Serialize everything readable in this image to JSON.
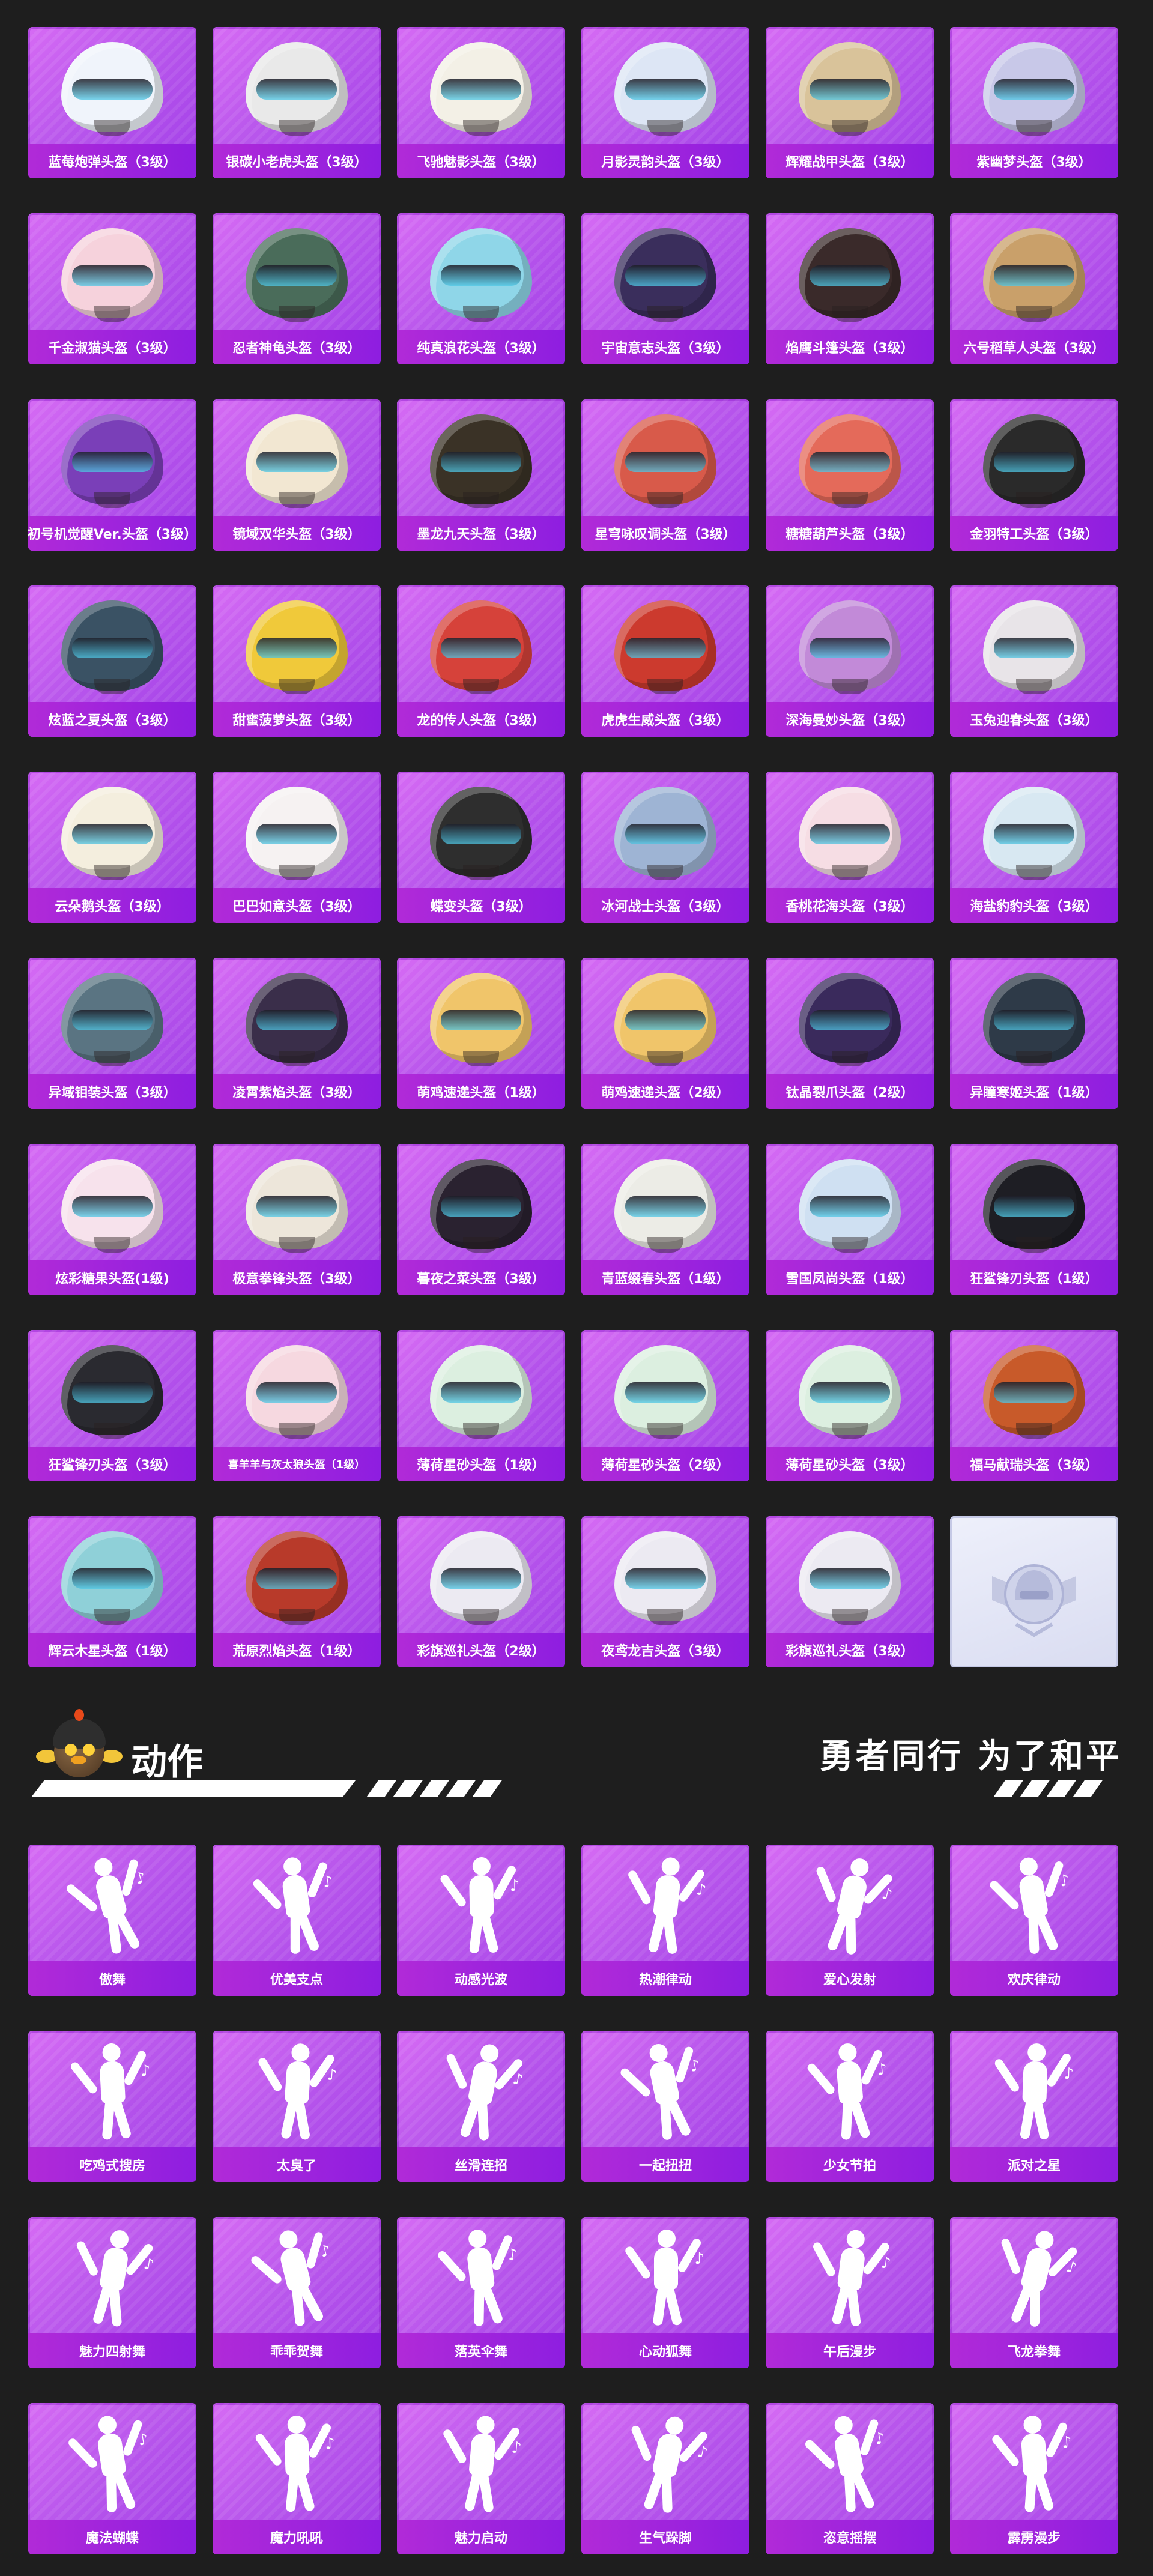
{
  "helmets": [
    {
      "label": "蓝莓炮弹头盔（3级）",
      "color": "#f0f4fb"
    },
    {
      "label": "银碳小老虎头盔（3级）",
      "color": "#e9e9e9"
    },
    {
      "label": "飞驰魅影头盔（3级）",
      "color": "#f3f0e6"
    },
    {
      "label": "月影灵韵头盔（3级）",
      "color": "#dde6f5"
    },
    {
      "label": "辉耀战甲头盔（3级）",
      "color": "#d9c39a"
    },
    {
      "label": "紫幽梦头盔（3级）",
      "color": "#c8c8e8"
    },
    {
      "label": "千金淑猫头盔（3级）",
      "color": "#f6d2dc"
    },
    {
      "label": "忍者神龟头盔（3级）",
      "color": "#4a6c5a"
    },
    {
      "label": "纯真浪花头盔（3级）",
      "color": "#8fd6e8"
    },
    {
      "label": "宇宙意志头盔（3级）",
      "color": "#3a2e5c"
    },
    {
      "label": "焰鹰斗篷头盔（3级）",
      "color": "#3a2a2a"
    },
    {
      "label": "六号稻草人头盔（3级）",
      "color": "#c9a06a"
    },
    {
      "label": "初号机觉醒Ver.头盔（3级）",
      "color": "#7a3fb8"
    },
    {
      "label": "镜域双华头盔（3级）",
      "color": "#f2e7d2"
    },
    {
      "label": "墨龙九天头盔（3级）",
      "color": "#3a3226"
    },
    {
      "label": "星穹咏叹调头盔（3级）",
      "color": "#d85a4a"
    },
    {
      "label": "糖糖葫芦头盔（3级）",
      "color": "#e46a5a"
    },
    {
      "label": "金羽特工头盔（3级）",
      "color": "#2a2a2a"
    },
    {
      "label": "炫蓝之夏头盔（3级）",
      "color": "#3a5264"
    },
    {
      "label": "甜蜜菠萝头盔（3级）",
      "color": "#f0c93a"
    },
    {
      "label": "龙的传人头盔（3级）",
      "color": "#d6423a"
    },
    {
      "label": "虎虎生威头盔（3级）",
      "color": "#cc3a2e"
    },
    {
      "label": "深海曼妙头盔（3级）",
      "color": "#c28ad8"
    },
    {
      "label": "玉兔迎春头盔（3级）",
      "color": "#e8e4e8"
    },
    {
      "label": "云朵鹅头盔（3级）",
      "color": "#f4eede"
    },
    {
      "label": "巴巴如意头盔（3级）",
      "color": "#f6f2f2"
    },
    {
      "label": "蝶变头盔（3级）",
      "color": "#2e2e2e"
    },
    {
      "label": "冰河战士头盔（3级）",
      "color": "#9eb4d4"
    },
    {
      "label": "香桃花海头盔（3级）",
      "color": "#f6dde4"
    },
    {
      "label": "海盐豹豹头盔（3级）",
      "color": "#d8e8f2"
    },
    {
      "label": "异域钼装头盔（3级）",
      "color": "#5a7482"
    },
    {
      "label": "凌霄紫焰头盔（3级）",
      "color": "#3a2e4a"
    },
    {
      "label": "萌鸡速递头盔（1级）",
      "color": "#f0c56a"
    },
    {
      "label": "萌鸡速递头盔（2级）",
      "color": "#f0c56a"
    },
    {
      "label": "钛晶裂爪头盔（2级）",
      "color": "#3a2a5c"
    },
    {
      "label": "异瞳寒姬头盔（1级）",
      "color": "#2e3a48"
    },
    {
      "label": "炫彩糖果头盔(1级)",
      "color": "#f7e2ec"
    },
    {
      "label": "极意拳锋头盔（3级）",
      "color": "#ede6da"
    },
    {
      "label": "暮夜之菜头盔（3级）",
      "color": "#2a2230"
    },
    {
      "label": "青蓝缀春头盔（1级）",
      "color": "#ecece6"
    },
    {
      "label": "雪国凤尚头盔（1级）",
      "color": "#cfe0f2"
    },
    {
      "label": "狂鲨锋刃头盔（1级）",
      "color": "#1e1e24"
    },
    {
      "label": "狂鲨锋刃头盔（3级）",
      "color": "#2a2a30"
    },
    {
      "label": "喜羊羊与灰太狼头盔（1级）",
      "color": "#f6d8e0",
      "small": true
    },
    {
      "label": "薄荷星砂头盔（1级）",
      "color": "#dcefe0"
    },
    {
      "label": "薄荷星砂头盔（2级）",
      "color": "#dcefe0"
    },
    {
      "label": "薄荷星砂头盔（3级）",
      "color": "#dcefe0"
    },
    {
      "label": "福马献瑞头盔（3级）",
      "color": "#c85a2a"
    },
    {
      "label": "辉云木星头盔（1级）",
      "color": "#8fd0d8"
    },
    {
      "label": "荒原烈焰头盔（1级）",
      "color": "#b83a2a"
    },
    {
      "label": "彩旗巡礼头盔（2级）",
      "color": "#eceaf2"
    },
    {
      "label": "夜鸢龙吉头盔（3级）",
      "color": "#eceaf2"
    },
    {
      "label": "彩旗巡礼头盔（3级）",
      "color": "#eceaf2"
    }
  ],
  "section": {
    "title": "动作",
    "slogan": "勇者同行 为了和平"
  },
  "emotes": [
    {
      "label": "傲舞"
    },
    {
      "label": "优美支点"
    },
    {
      "label": "动感光波"
    },
    {
      "label": "热潮律动"
    },
    {
      "label": "爱心发射"
    },
    {
      "label": "欢庆律动"
    },
    {
      "label": "吃鸡式搜房"
    },
    {
      "label": "太臭了"
    },
    {
      "label": "丝滑连招"
    },
    {
      "label": "一起扭扭"
    },
    {
      "label": "少女节拍"
    },
    {
      "label": "派对之星"
    },
    {
      "label": "魅力四射舞"
    },
    {
      "label": "乖乖贺舞"
    },
    {
      "label": "落英伞舞"
    },
    {
      "label": "心动狐舞"
    },
    {
      "label": "午后漫步"
    },
    {
      "label": "飞龙拳舞"
    },
    {
      "label": "魔法蝴蝶"
    },
    {
      "label": "魔力吼吼"
    },
    {
      "label": "魅力启动"
    },
    {
      "label": "生气跺脚"
    },
    {
      "label": "恣意摇摆"
    },
    {
      "label": "霹雳漫步"
    }
  ]
}
